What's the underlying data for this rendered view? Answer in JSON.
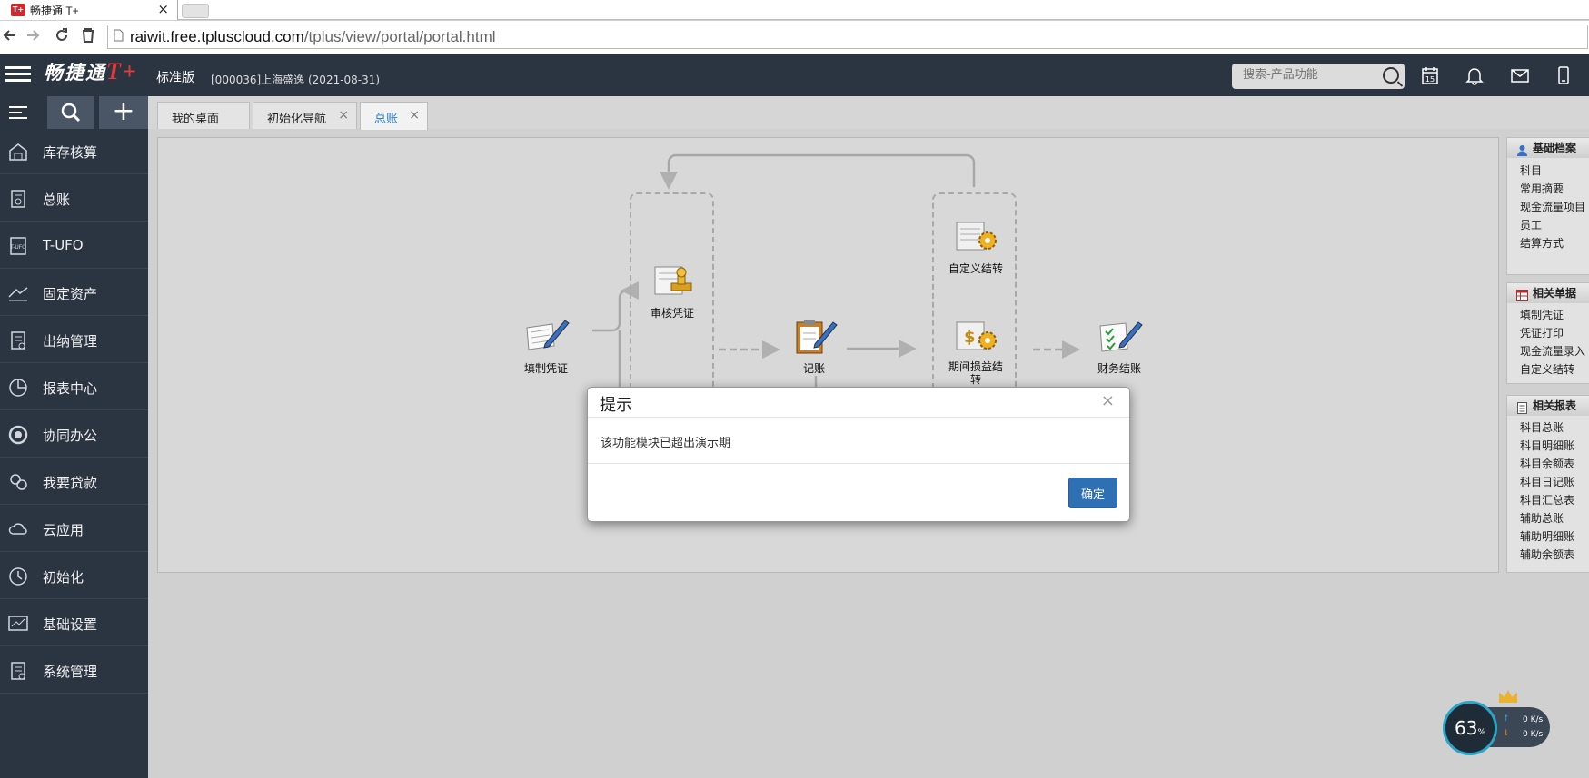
{
  "browser": {
    "tab_title": "畅捷通 T+",
    "tab_close": "×",
    "favicon_text": "T+",
    "url_host": "raiwit.free.tpluscloud.com",
    "url_path": "/tplus/view/portal/portal.html"
  },
  "header": {
    "logo_text": "畅捷通",
    "logo_tplus": "T+",
    "edition": "标准版",
    "company": "[000036]上海盛逸   (2021-08-31)",
    "search_placeholder": "搜索-产品功能",
    "calendar_day": "15"
  },
  "sidebar": {
    "add_label": "+",
    "items": [
      {
        "label": "库存核算",
        "icon": "warehouse-icon"
      },
      {
        "label": "总账",
        "icon": "ledger-icon"
      },
      {
        "label": "T-UFO",
        "icon": "tufo-icon"
      },
      {
        "label": "固定资产",
        "icon": "asset-icon"
      },
      {
        "label": "出纳管理",
        "icon": "cashier-icon"
      },
      {
        "label": "报表中心",
        "icon": "report-icon"
      },
      {
        "label": "协同办公",
        "icon": "collab-icon"
      },
      {
        "label": "我要贷款",
        "icon": "loan-icon"
      },
      {
        "label": "云应用",
        "icon": "cloud-icon"
      },
      {
        "label": "初始化",
        "icon": "init-icon"
      },
      {
        "label": "基础设置",
        "icon": "settings-icon"
      },
      {
        "label": "系统管理",
        "icon": "system-icon"
      }
    ]
  },
  "tabs": [
    {
      "label": "我的桌面",
      "closable": false
    },
    {
      "label": "初始化导航",
      "closable": true
    },
    {
      "label": "总账",
      "closable": true,
      "active": true
    }
  ],
  "tab_close": "×",
  "flow": {
    "fill_voucher": "填制凭证",
    "audit_voucher": "审核凭证",
    "post_entry": "记账",
    "custom_transfer": "自定义结转",
    "period_pl_transfer": "期间损益结转",
    "period_close": "财务结账"
  },
  "right_panel": {
    "basic_title": "基础档案",
    "basic_items": [
      "科目",
      "常用摘要",
      "现金流量项目",
      "员工",
      "结算方式"
    ],
    "docs_title": "相关单据",
    "docs_items": [
      "填制凭证",
      "凭证打印",
      "现金流量录入",
      "自定义结转"
    ],
    "reports_title": "相关报表",
    "reports_items": [
      "科目总账",
      "科目明细账",
      "科目余额表",
      "科目日记账",
      "科目汇总表",
      "辅助总账",
      "辅助明细账",
      "辅助余额表"
    ]
  },
  "modal": {
    "title": "提示",
    "close": "×",
    "message": "该功能模块已超出演示期",
    "ok_label": "确定"
  },
  "network_widget": {
    "percent": "63",
    "percent_unit": "%",
    "up_speed": "0 K/s",
    "down_speed": "0 K/s",
    "up_arrow": "↑",
    "down_arrow": "↓"
  },
  "colors": {
    "header_bg": "#2b3541",
    "accent": "#2f83c7",
    "ok_button": "#2f6fb3",
    "logo_red": "#e23b3b"
  }
}
